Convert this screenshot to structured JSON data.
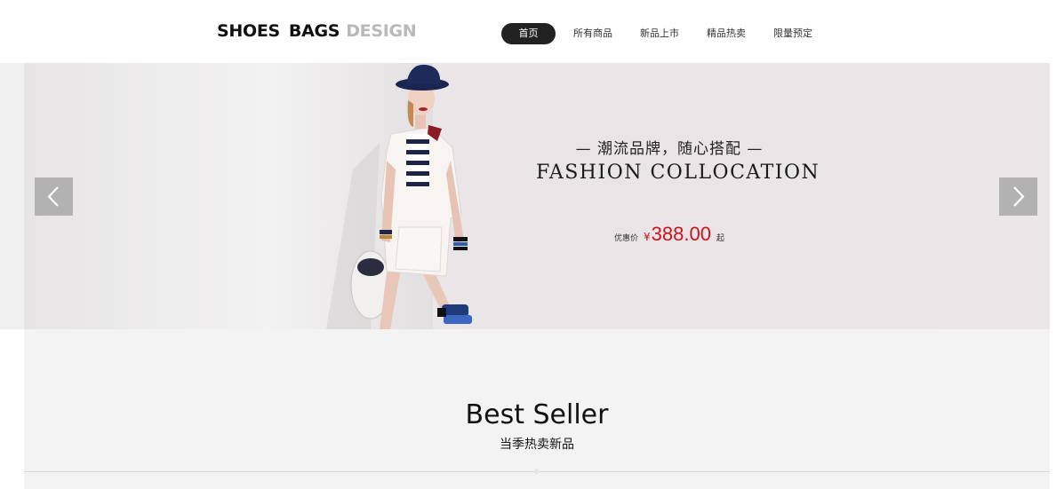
{
  "header": {
    "logo": {
      "word1": "SHOES",
      "word2": "BAGS",
      "word3": "DESIGN"
    },
    "nav": [
      {
        "label": "首页",
        "active": true
      },
      {
        "label": "所有商品",
        "active": false
      },
      {
        "label": "新品上市",
        "active": false
      },
      {
        "label": "精品热卖",
        "active": false
      },
      {
        "label": "限量预定",
        "active": false
      }
    ]
  },
  "banner": {
    "slogan_cn": "— 潮流品牌，随心搭配 —",
    "slogan_en": "FASHION COLLOCATION",
    "price_label": "优惠价",
    "price_currency": "¥",
    "price_value": "388.00",
    "price_suffix": "起",
    "prev_icon": "chevron-left-icon",
    "next_icon": "chevron-right-icon"
  },
  "section": {
    "title": "Best Seller",
    "subtitle": "当季热卖新品"
  },
  "colors": {
    "accent_price": "#d0111b",
    "nav_active_bg": "#222222",
    "logo_gray": "#b9b9b9"
  }
}
